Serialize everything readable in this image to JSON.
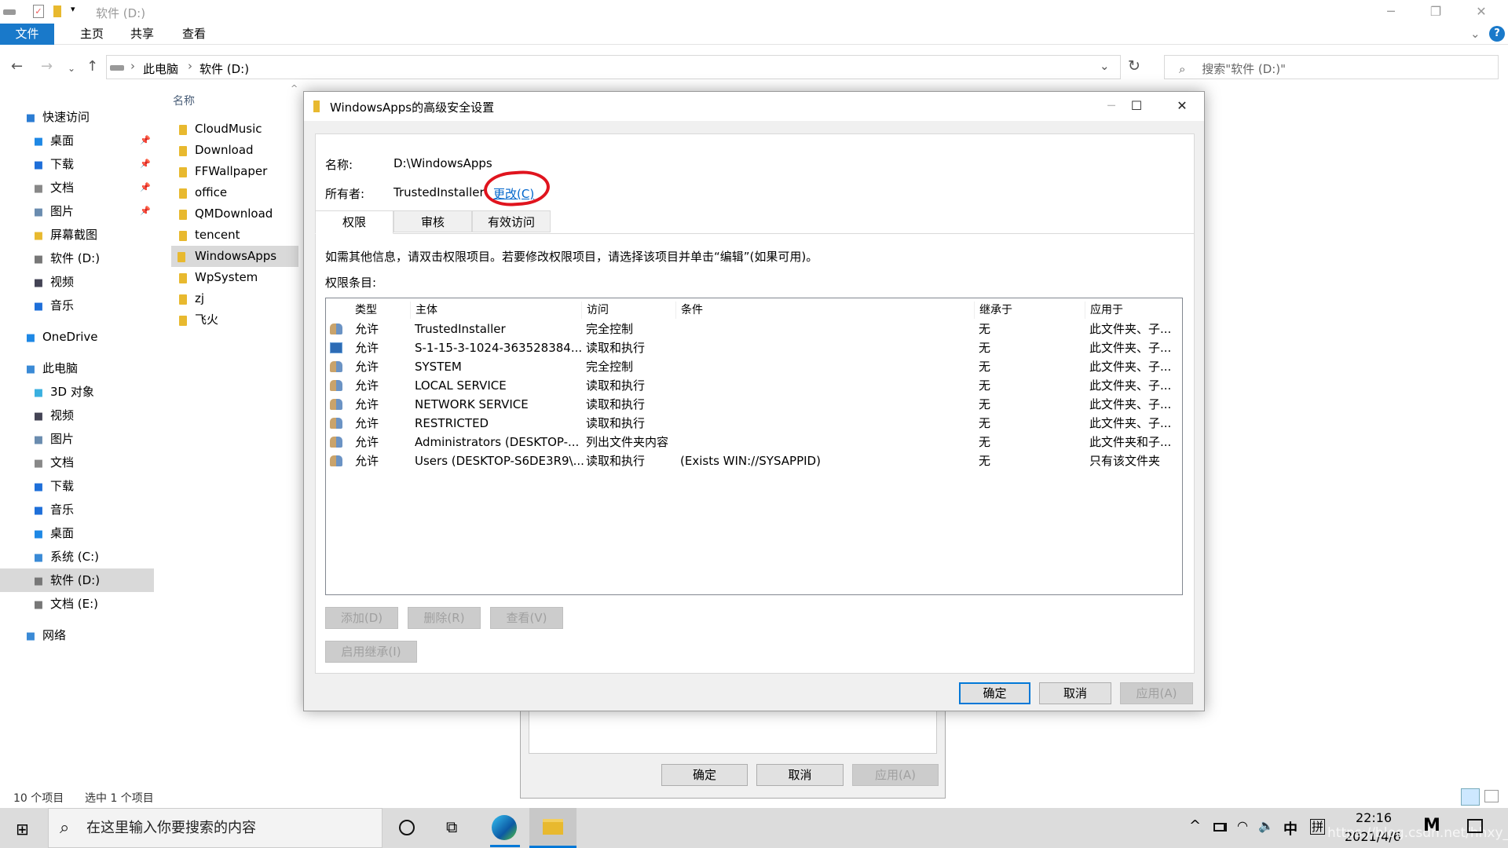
{
  "explorer": {
    "title": "软件 (D:)",
    "ribbon_tabs": [
      "文件",
      "主页",
      "共享",
      "查看"
    ],
    "breadcrumb": [
      "此电脑",
      "软件 (D:)"
    ],
    "search_placeholder": "搜索\"软件 (D:)\"",
    "sidebar": [
      {
        "label": "快速访问",
        "icon": "star-icon",
        "color": "#2b7cd3",
        "level": 0
      },
      {
        "label": "桌面",
        "icon": "desktop-icon",
        "color": "#1e88e5",
        "level": 1,
        "pinned": true
      },
      {
        "label": "下载",
        "icon": "download-icon",
        "color": "#1e6fd9",
        "level": 1,
        "pinned": true
      },
      {
        "label": "文档",
        "icon": "document-icon",
        "color": "#888",
        "level": 1,
        "pinned": true
      },
      {
        "label": "图片",
        "icon": "picture-icon",
        "color": "#6a8caf",
        "level": 1,
        "pinned": true
      },
      {
        "label": "屏幕截图",
        "icon": "folder-icon",
        "color": "#e8b92f",
        "level": 1
      },
      {
        "label": "软件 (D:)",
        "icon": "drive-icon",
        "color": "#777",
        "level": 1
      },
      {
        "label": "视频",
        "icon": "video-icon",
        "color": "#445",
        "level": 1
      },
      {
        "label": "音乐",
        "icon": "music-icon",
        "color": "#1e6fd9",
        "level": 1
      },
      {
        "label": "OneDrive",
        "icon": "cloud-icon",
        "color": "#1e88e5",
        "level": 0,
        "gap": true
      },
      {
        "label": "此电脑",
        "icon": "computer-icon",
        "color": "#3a8ad6",
        "level": 0,
        "gap": true
      },
      {
        "label": "3D 对象",
        "icon": "cube-icon",
        "color": "#3ab0e0",
        "level": 1
      },
      {
        "label": "视频",
        "icon": "video-icon",
        "color": "#445",
        "level": 1
      },
      {
        "label": "图片",
        "icon": "picture-icon",
        "color": "#6a8caf",
        "level": 1
      },
      {
        "label": "文档",
        "icon": "document-icon",
        "color": "#888",
        "level": 1
      },
      {
        "label": "下载",
        "icon": "download-icon",
        "color": "#1e6fd9",
        "level": 1
      },
      {
        "label": "音乐",
        "icon": "music-icon",
        "color": "#1e6fd9",
        "level": 1
      },
      {
        "label": "桌面",
        "icon": "desktop-icon",
        "color": "#1e88e5",
        "level": 1
      },
      {
        "label": "系统 (C:)",
        "icon": "system-drive-icon",
        "color": "#3a8ad6",
        "level": 1
      },
      {
        "label": "软件 (D:)",
        "icon": "drive-icon",
        "color": "#777",
        "level": 1,
        "selected": true
      },
      {
        "label": "文档 (E:)",
        "icon": "drive-icon",
        "color": "#777",
        "level": 1
      },
      {
        "label": "网络",
        "icon": "network-icon",
        "color": "#3a8ad6",
        "level": 0,
        "gap": true
      }
    ],
    "column_name": "名称",
    "files": [
      "CloudMusic",
      "Download",
      "FFWallpaper",
      "office",
      "QMDownload",
      "tencent",
      "WindowsApps",
      "WpSystem",
      "zj",
      "飞火"
    ],
    "selected_file": "WindowsApps",
    "status_items": "10 个项目",
    "status_selected": "选中 1 个项目"
  },
  "background_dialog": {
    "ok": "确定",
    "cancel": "取消",
    "apply": "应用(A)"
  },
  "dialog": {
    "title": "WindowsApps的高级安全设置",
    "name_label": "名称:",
    "name_value": "D:\\WindowsApps",
    "owner_label": "所有者:",
    "owner_value": "TrustedInstaller",
    "change_link": "更改(C)",
    "annotation_color": "#e0141e",
    "tabs": [
      "权限",
      "审核",
      "有效访问"
    ],
    "active_tab": "权限",
    "info_text": "如需其他信息，请双击权限项目。若要修改权限项目，请选择该项目并单击“编辑”(如果可用)。",
    "entries_label": "权限条目:",
    "columns": [
      "类型",
      "主体",
      "访问",
      "条件",
      "继承于",
      "应用于"
    ],
    "rows": [
      {
        "icon": "users-icon",
        "type": "允许",
        "principal": "TrustedInstaller",
        "access": "完全控制",
        "condition": "",
        "inherited": "无",
        "applies": "此文件夹、子..."
      },
      {
        "icon": "app-package-icon",
        "type": "允许",
        "principal": "S-1-15-3-1024-363528384...",
        "access": "读取和执行",
        "condition": "",
        "inherited": "无",
        "applies": "此文件夹、子..."
      },
      {
        "icon": "users-icon",
        "type": "允许",
        "principal": "SYSTEM",
        "access": "完全控制",
        "condition": "",
        "inherited": "无",
        "applies": "此文件夹、子..."
      },
      {
        "icon": "users-icon",
        "type": "允许",
        "principal": "LOCAL SERVICE",
        "access": "读取和执行",
        "condition": "",
        "inherited": "无",
        "applies": "此文件夹、子..."
      },
      {
        "icon": "users-icon",
        "type": "允许",
        "principal": "NETWORK SERVICE",
        "access": "读取和执行",
        "condition": "",
        "inherited": "无",
        "applies": "此文件夹、子..."
      },
      {
        "icon": "users-icon",
        "type": "允许",
        "principal": "RESTRICTED",
        "access": "读取和执行",
        "condition": "",
        "inherited": "无",
        "applies": "此文件夹、子..."
      },
      {
        "icon": "users-icon",
        "type": "允许",
        "principal": "Administrators (DESKTOP-...",
        "access": "列出文件夹内容",
        "condition": "",
        "inherited": "无",
        "applies": "此文件夹和子..."
      },
      {
        "icon": "users-icon",
        "type": "允许",
        "principal": "Users (DESKTOP-S6DE3R9\\...",
        "access": "读取和执行",
        "condition": "(Exists WIN://SYSAPPID)",
        "inherited": "无",
        "applies": "只有该文件夹"
      }
    ],
    "add": "添加(D)",
    "remove": "删除(R)",
    "view": "查看(V)",
    "enable_inheritance": "启用继承(I)",
    "ok": "确定",
    "cancel": "取消",
    "apply": "应用(A)"
  },
  "taskbar": {
    "search_placeholder": "在这里输入你要搜索的内容",
    "ime_lang": "中",
    "ime_mode": "拼",
    "time": "22:16",
    "date": "2021/4/6",
    "watermark": "https://blog.csdn.net/hhxy_wlzx"
  }
}
